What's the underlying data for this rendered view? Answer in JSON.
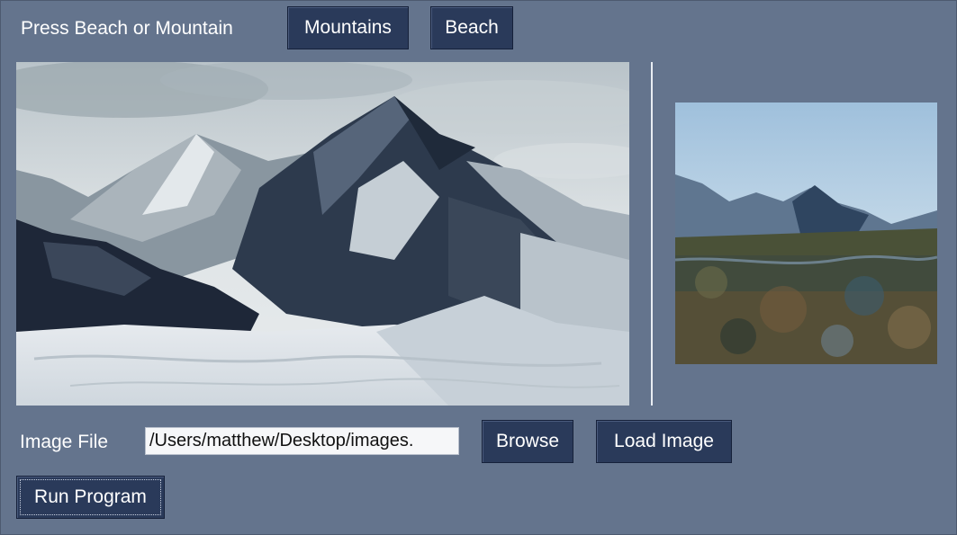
{
  "header": {
    "prompt_label": "Press Beach or Mountain",
    "mountains_button": "Mountains",
    "beach_button": "Beach"
  },
  "images": {
    "main_image": "mountain-painting-image",
    "stylized_image": "stylized-output-image"
  },
  "file_row": {
    "label": "Image File",
    "path_value": "/Users/matthew/Desktop/images.",
    "browse_button": "Browse",
    "load_button": "Load Image"
  },
  "actions": {
    "run_button": "Run Program"
  },
  "colors": {
    "background": "#64748d",
    "button": "#2a3a5a",
    "text": "#ffffff"
  }
}
